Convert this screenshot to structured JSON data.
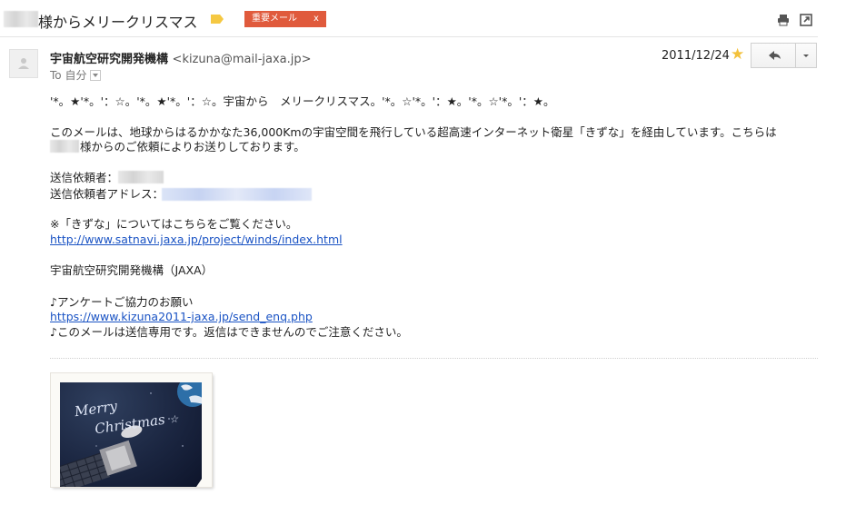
{
  "subject": {
    "text": "様からメリークリスマス",
    "label_color": "#f5c842",
    "tag": {
      "text": "重要メール",
      "close": "x",
      "color": "#e05a3c"
    }
  },
  "toolbar": {
    "print_icon": "print-icon",
    "newwin_icon": "new-window-icon"
  },
  "header": {
    "sender_name": "宇宙航空研究開発機構",
    "sender_email": "<kizuna@mail-jaxa.jp>",
    "to_label": "To 自分",
    "date": "2011/12/24",
    "star": "★",
    "reply_icon": "reply-icon",
    "more_icon": "chevron-down-icon"
  },
  "body": {
    "greeting": "'*。★'*。'：☆。'*。★'*。'：☆。宇宙から　メリークリスマス。'*。☆'*。'：★。'*。☆'*。'：★。",
    "p1_line1": "このメールは、地球からはるかかなた36,000Kmの宇宙空間を飛行している超高速インターネット衛星「きずな」を経由しています。こちらは",
    "p1_line2": "様からのご依頼によりお送りしております。",
    "requester_label": "送信依頼者：",
    "requester_addr_label": "送信依頼者アドレス：",
    "kizuna_note": "※「きずな」についてはこちらをご覧ください。",
    "kizuna_url": "http://www.satnavi.jaxa.jp/project/winds/index.html",
    "org": "宇宙航空研究開発機構（JAXA）",
    "survey_label": "♪アンケートご協力のお願い",
    "survey_url": "https://www.kizuna2011-jaxa.jp/send_enq.php",
    "footer_note": "♪このメールは送信専用です。返信はできませんのでご注意ください。"
  },
  "card": {
    "line1": "Merry",
    "line2": "Christmas",
    "star": "☆"
  }
}
